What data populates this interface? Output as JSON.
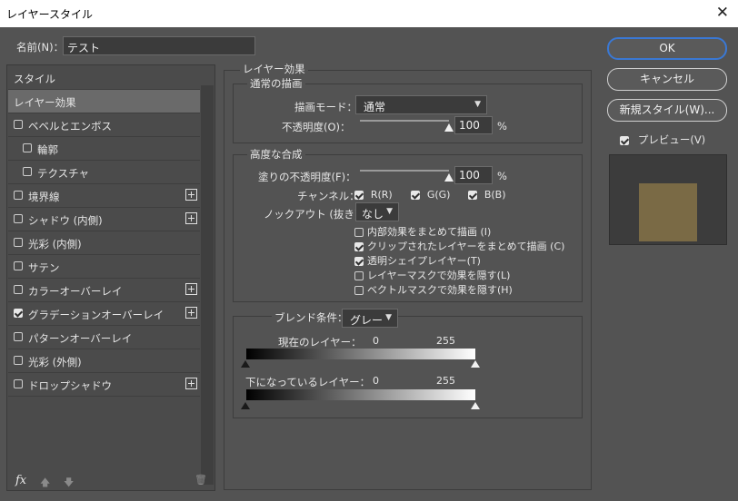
{
  "window": {
    "title": "レイヤースタイル",
    "close_glyph": "✕"
  },
  "name_field": {
    "label": "名前(N)：",
    "value": "テスト"
  },
  "buttons": {
    "ok": "OK",
    "cancel": "キャンセル",
    "new_style": "新規スタイル(W)...",
    "preview_label": "プレビュー(V)"
  },
  "preview_color": "#7a6a45",
  "style_list": [
    {
      "label": "スタイル",
      "has_checkbox": false,
      "checked": false,
      "plus": false,
      "selected": false,
      "indent": false
    },
    {
      "label": "レイヤー効果",
      "has_checkbox": false,
      "checked": false,
      "plus": false,
      "selected": true,
      "indent": false
    },
    {
      "label": "ベベルとエンボス",
      "has_checkbox": true,
      "checked": false,
      "plus": false,
      "selected": false,
      "indent": false
    },
    {
      "label": "輪郭",
      "has_checkbox": true,
      "checked": false,
      "plus": false,
      "selected": false,
      "indent": true
    },
    {
      "label": "テクスチャ",
      "has_checkbox": true,
      "checked": false,
      "plus": false,
      "selected": false,
      "indent": true
    },
    {
      "label": "境界線",
      "has_checkbox": true,
      "checked": false,
      "plus": true,
      "selected": false,
      "indent": false
    },
    {
      "label": "シャドウ (内側)",
      "has_checkbox": true,
      "checked": false,
      "plus": true,
      "selected": false,
      "indent": false
    },
    {
      "label": "光彩 (内側)",
      "has_checkbox": true,
      "checked": false,
      "plus": false,
      "selected": false,
      "indent": false
    },
    {
      "label": "サテン",
      "has_checkbox": true,
      "checked": false,
      "plus": false,
      "selected": false,
      "indent": false
    },
    {
      "label": "カラーオーバーレイ",
      "has_checkbox": true,
      "checked": false,
      "plus": true,
      "selected": false,
      "indent": false
    },
    {
      "label": "グラデーションオーバーレイ",
      "has_checkbox": true,
      "checked": true,
      "plus": true,
      "selected": false,
      "indent": false
    },
    {
      "label": "パターンオーバーレイ",
      "has_checkbox": true,
      "checked": false,
      "plus": false,
      "selected": false,
      "indent": false
    },
    {
      "label": "光彩 (外側)",
      "has_checkbox": true,
      "checked": false,
      "plus": false,
      "selected": false,
      "indent": false
    },
    {
      "label": "ドロップシャドウ",
      "has_checkbox": true,
      "checked": false,
      "plus": true,
      "selected": false,
      "indent": false
    }
  ],
  "bottom_icons": {
    "fx": "fx",
    "up": "🡅",
    "down": "🡇",
    "trash": "🗑"
  },
  "effects": {
    "title": "レイヤー効果",
    "general_blend": {
      "title": "通常の描画",
      "blend_mode_label": "描画モード：",
      "blend_mode_value": "通常",
      "opacity_label": "不透明度(O)：",
      "opacity_value": "100",
      "opacity_pct": 100,
      "unit": "%"
    },
    "advanced_blend": {
      "title": "高度な合成",
      "fill_label": "塗りの不透明度(F)：",
      "fill_value": "100",
      "fill_pct": 100,
      "unit": "%",
      "channels_label": "チャンネル：",
      "channels": [
        {
          "label": "R(R)",
          "checked": true
        },
        {
          "label": "G(G)",
          "checked": true
        },
        {
          "label": "B(B)",
          "checked": true
        }
      ],
      "knockout_label": "ノックアウト (抜き)：",
      "knockout_value": "なし",
      "options": [
        {
          "label": "内部効果をまとめて描画 (I)",
          "checked": false
        },
        {
          "label": "クリップされたレイヤーをまとめて描画 (C)",
          "checked": true
        },
        {
          "label": "透明シェイプレイヤー(T)",
          "checked": true
        },
        {
          "label": "レイヤーマスクで効果を隠す(L)",
          "checked": false
        },
        {
          "label": "ベクトルマスクで効果を隠す(H)",
          "checked": false
        }
      ]
    },
    "blend_if": {
      "label": "ブレンド条件：",
      "value": "グレー",
      "this_layer": {
        "label": "現在のレイヤー：",
        "min": "0",
        "max": "255"
      },
      "underlying": {
        "label": "下になっているレイヤー：",
        "min": "0",
        "max": "255"
      }
    }
  }
}
